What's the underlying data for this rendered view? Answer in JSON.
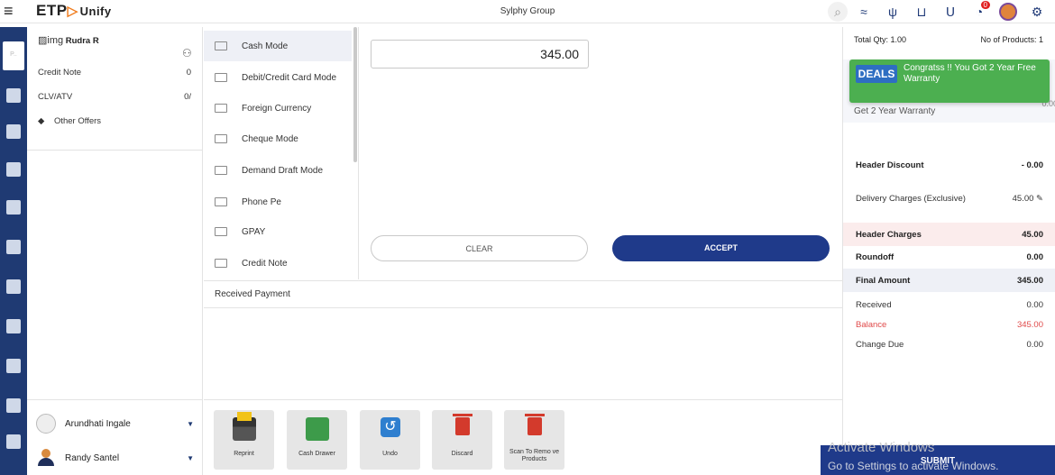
{
  "header": {
    "brand": "ETP",
    "brand_suffix": "Unify",
    "company": "Sylphy Group",
    "notification_count": "0"
  },
  "icons": {
    "menu": "hamburger-icon",
    "search": "search-icon",
    "bell": "bell-icon",
    "settings": "gear-icon"
  },
  "customer": {
    "name": "Rudra R",
    "credit_note_label": "Credit Note",
    "credit_note_value": "0",
    "clv_label": "CLV/ATV",
    "clv_value": "0/",
    "offers_label": "Other Offers"
  },
  "salespersons": [
    {
      "name": "Arundhati Ingale"
    },
    {
      "name": "Randy Santel"
    }
  ],
  "payment_modes": [
    {
      "label": "Cash Mode"
    },
    {
      "label": "Debit/Credit Card Mode"
    },
    {
      "label": "Foreign Currency"
    },
    {
      "label": "Cheque Mode"
    },
    {
      "label": "Demand Draft Mode"
    },
    {
      "label": "Phone Pe"
    },
    {
      "label": "GPAY"
    },
    {
      "label": "Credit Note"
    }
  ],
  "entry": {
    "amount": "345.00",
    "clear_label": "CLEAR",
    "accept_label": "ACCEPT"
  },
  "received_title": "Received Payment",
  "actions": [
    {
      "label": "Reprint"
    },
    {
      "label": "Cash Drawer"
    },
    {
      "label": "Undo"
    },
    {
      "label": "Discard"
    },
    {
      "label": "Scan To Remo ve Products"
    }
  ],
  "summary": {
    "total_qty": "Total Qty: 1.00",
    "no_products": "No of Products: 1",
    "toast": "Congratss !! You Got 2 Year Free Warranty",
    "deal_badge": "DEALS",
    "warranty_label": "Get 2 Year Warranty",
    "warranty_value": "0.00",
    "header_discount_label": "Header Discount",
    "header_discount_value": "- 0.00",
    "delivery_label": "Delivery Charges (Exclusive)",
    "delivery_value": "45.00",
    "header_charges_label": "Header Charges",
    "header_charges_value": "45.00",
    "roundoff_label": "Roundoff",
    "roundoff_value": "0.00",
    "final_label": "Final Amount",
    "final_value": "345.00",
    "received_label": "Received",
    "received_value": "0.00",
    "balance_label": "Balance",
    "balance_value": "345.00",
    "change_label": "Change Due",
    "change_value": "0.00",
    "submit_label": "SUBMIT"
  },
  "watermark": {
    "line1": "Activate Windows",
    "line2": "Go to Settings to activate Windows."
  }
}
